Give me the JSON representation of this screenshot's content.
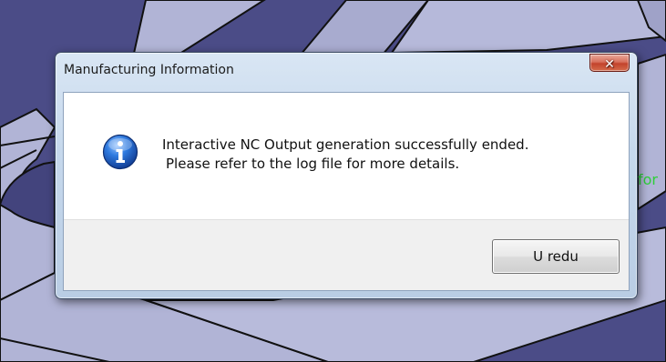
{
  "dialog": {
    "title": "Manufacturing Information",
    "close_glyph": "✕",
    "icon": "info-icon",
    "message_line_1": "Interactive NC Output generation successfully ended.",
    "message_line_2": "Please refer to the log file for more details.",
    "ok_label": "U redu"
  },
  "background": {
    "visible_text": "for"
  },
  "colors": {
    "canvas_background": "#4b4c87",
    "part_face": "#b1b4d6",
    "part_edge": "#111111",
    "background_text": "#2ecf3a",
    "close_button": "#c3432c",
    "info_icon_blue": "#1e5fbf"
  }
}
